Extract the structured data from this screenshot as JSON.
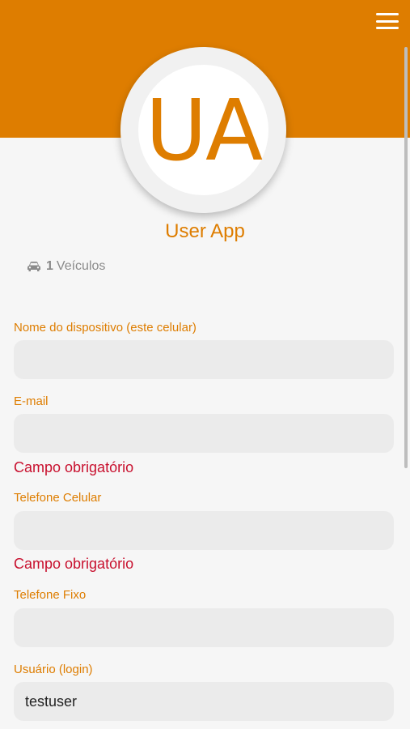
{
  "header": {
    "menu_icon": "hamburger-menu-icon",
    "color": "#de7d00"
  },
  "profile": {
    "initials": "UA",
    "name": "User App",
    "vehicle_icon": "car-icon",
    "vehicle_count": "1",
    "vehicle_label": "Veículos"
  },
  "form": {
    "device_name": {
      "label": "Nome do dispositivo (este celular)",
      "value": ""
    },
    "email": {
      "label": "E-mail",
      "value": "",
      "error": "Campo obrigatório"
    },
    "mobile_phone": {
      "label": "Telefone Celular",
      "value": "",
      "error": "Campo obrigatório"
    },
    "landline": {
      "label": "Telefone Fixo",
      "value": ""
    },
    "username": {
      "label": "Usuário (login)",
      "value": "testuser"
    }
  },
  "colors": {
    "accent": "#de7d00",
    "error": "#c8102e",
    "background": "#f6f6f6",
    "input_bg": "#ebebeb"
  }
}
